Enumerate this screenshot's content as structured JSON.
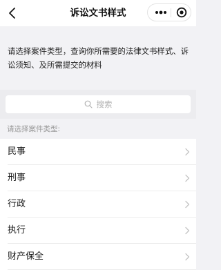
{
  "header": {
    "title": "诉讼文书样式"
  },
  "intro": {
    "text": "请选择案件类型，查询你所需要的法律文书样式、诉讼须知、及所需提交的材料"
  },
  "search": {
    "placeholder": "搜索"
  },
  "list": {
    "section_label": "请选择案件类型:",
    "items": [
      {
        "label": "民事"
      },
      {
        "label": "刑事"
      },
      {
        "label": "行政"
      },
      {
        "label": "执行"
      },
      {
        "label": "财产保全"
      }
    ]
  }
}
